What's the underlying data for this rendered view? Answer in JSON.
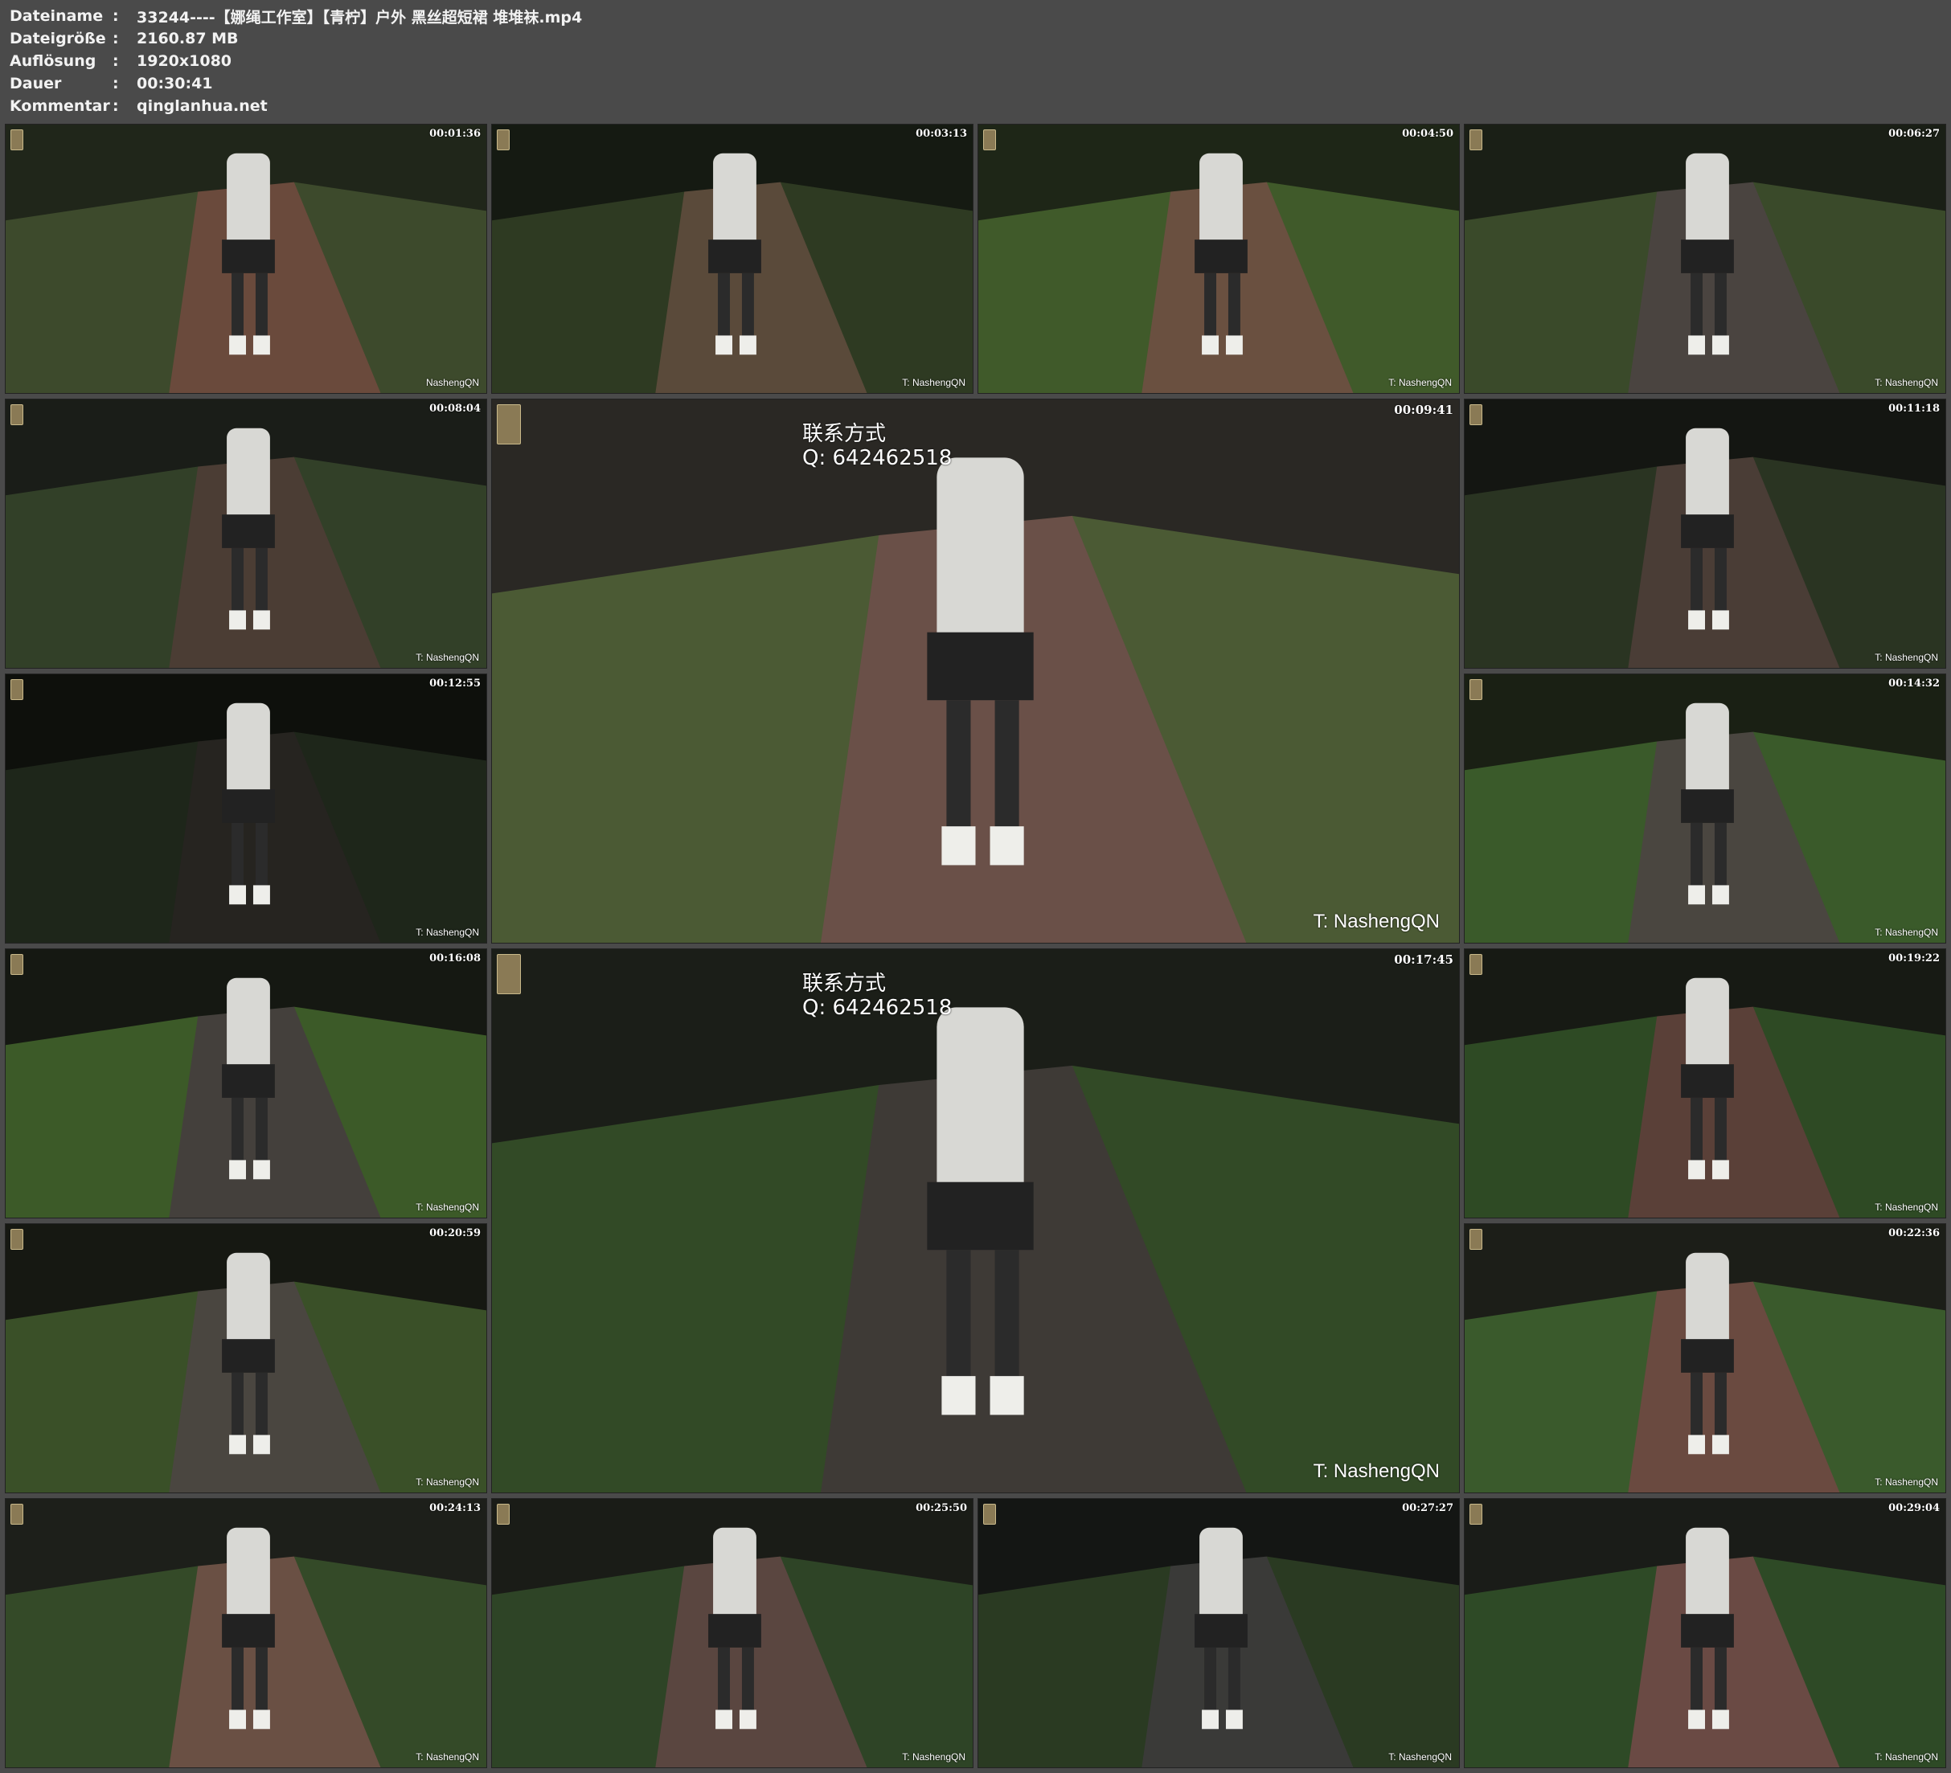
{
  "info": [
    {
      "key": "Dateiname",
      "sep": ":",
      "value": "33244----【娜绳工作室】【青柠】户外 黑丝超短裙 堆堆袜.mp4"
    },
    {
      "key": "Dateigröße",
      "sep": ":",
      "value": "2160.87 MB"
    },
    {
      "key": "Auflösung",
      "sep": ":",
      "value": "1920x1080"
    },
    {
      "key": "Dauer",
      "sep": ":",
      "value": "00:30:41"
    },
    {
      "key": "Kommentar",
      "sep": ":",
      "value": "qinglanhua.net"
    }
  ],
  "thumbnails": [
    {
      "timestamp": "00:01:36",
      "watermark": "NashengQN"
    },
    {
      "timestamp": "00:03:13",
      "watermark": "T:  NashengQN"
    },
    {
      "timestamp": "00:04:50",
      "watermark": "T:  NashengQN"
    },
    {
      "timestamp": "00:06:27",
      "watermark": "T:  NashengQN"
    },
    {
      "timestamp": "00:08:04",
      "watermark": "T:  NashengQN"
    },
    {
      "timestamp": "00:09:41",
      "watermark": "T:  NashengQN",
      "contact": [
        "联系方式",
        "Q:  642462518"
      ]
    },
    {
      "timestamp": "00:11:18",
      "watermark": "T:  NashengQN"
    },
    {
      "timestamp": "00:12:55",
      "watermark": "T:  NashengQN"
    },
    {
      "timestamp": "00:14:32",
      "watermark": "T:  NashengQN"
    },
    {
      "timestamp": "00:16:08",
      "watermark": "T:  NashengQN"
    },
    {
      "timestamp": "00:17:45",
      "watermark": "T:  NashengQN",
      "contact": [
        "联系方式",
        "Q:  642462518"
      ]
    },
    {
      "timestamp": "00:19:22",
      "watermark": "T:  NashengQN"
    },
    {
      "timestamp": "00:20:59",
      "watermark": "T:  NashengQN"
    },
    {
      "timestamp": "00:22:36",
      "watermark": "T:  NashengQN"
    },
    {
      "timestamp": "00:24:13",
      "watermark": "T:  NashengQN"
    },
    {
      "timestamp": "00:25:50",
      "watermark": "T:  NashengQN"
    },
    {
      "timestamp": "00:27:27",
      "watermark": "T:  NashengQN"
    },
    {
      "timestamp": "00:29:04",
      "watermark": "T:  NashengQN"
    }
  ]
}
